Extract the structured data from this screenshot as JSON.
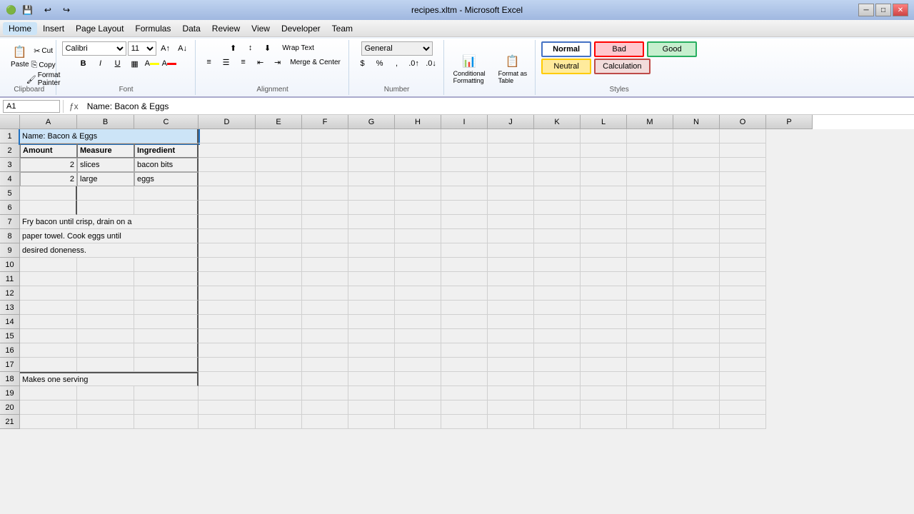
{
  "titlebar": {
    "text": "recipes.xltm - Microsoft Excel",
    "minimize": "─",
    "restore": "□",
    "close": "✕"
  },
  "menu": {
    "items": [
      "Home",
      "Insert",
      "Page Layout",
      "Formulas",
      "Data",
      "Review",
      "View",
      "Developer",
      "Team"
    ]
  },
  "ribbon": {
    "clipboard": {
      "label": "Clipboard",
      "paste": "Paste",
      "cut": "Cut",
      "copy": "Copy",
      "format_painter": "Format Painter"
    },
    "font": {
      "label": "Font",
      "family": "Calibri",
      "size": "11",
      "bold": "B",
      "italic": "I",
      "underline": "U"
    },
    "alignment": {
      "label": "Alignment",
      "wrap_text": "Wrap Text",
      "merge_center": "Merge & Center"
    },
    "number": {
      "label": "Number",
      "format": "General"
    },
    "styles": {
      "label": "Styles",
      "normal": "Normal",
      "bad": "Bad",
      "neutral": "Neutral",
      "calculation": "Calculation"
    }
  },
  "formula_bar": {
    "cell_ref": "A1",
    "formula": "Name: Bacon & Eggs"
  },
  "columns": [
    "A",
    "B",
    "C",
    "D",
    "E",
    "F",
    "G",
    "H",
    "I",
    "J",
    "K",
    "L",
    "M",
    "N",
    "O",
    "P"
  ],
  "rows": [
    {
      "num": 1,
      "cells": [
        "Name: Bacon & Eggs",
        "",
        "",
        "",
        "",
        "",
        "",
        "",
        "",
        "",
        "",
        "",
        "",
        "",
        "",
        ""
      ]
    },
    {
      "num": 2,
      "cells": [
        "Amount",
        "Measure",
        "Ingredient",
        "",
        "",
        "",
        "",
        "",
        "",
        "",
        "",
        "",
        "",
        "",
        "",
        ""
      ]
    },
    {
      "num": 3,
      "cells": [
        "2",
        "slices",
        "bacon bits",
        "",
        "",
        "",
        "",
        "",
        "",
        "",
        "",
        "",
        "",
        "",
        "",
        ""
      ]
    },
    {
      "num": 4,
      "cells": [
        "2",
        "large",
        "eggs",
        "",
        "",
        "",
        "",
        "",
        "",
        "",
        "",
        "",
        "",
        "",
        "",
        ""
      ]
    },
    {
      "num": 5,
      "cells": [
        "",
        "",
        "",
        "",
        "",
        "",
        "",
        "",
        "",
        "",
        "",
        "",
        "",
        "",
        "",
        ""
      ]
    },
    {
      "num": 6,
      "cells": [
        "",
        "",
        "",
        "",
        "",
        "",
        "",
        "",
        "",
        "",
        "",
        "",
        "",
        "",
        "",
        ""
      ]
    },
    {
      "num": 7,
      "cells": [
        "Fry bacon until crisp, drain on a",
        "",
        "",
        "",
        "",
        "",
        "",
        "",
        "",
        "",
        "",
        "",
        "",
        "",
        "",
        ""
      ]
    },
    {
      "num": 8,
      "cells": [
        "paper towel.  Cook eggs until",
        "",
        "",
        "",
        "",
        "",
        "",
        "",
        "",
        "",
        "",
        "",
        "",
        "",
        "",
        ""
      ]
    },
    {
      "num": 9,
      "cells": [
        "desired doneness.",
        "",
        "",
        "",
        "",
        "",
        "",
        "",
        "",
        "",
        "",
        "",
        "",
        "",
        "",
        ""
      ]
    },
    {
      "num": 10,
      "cells": [
        "",
        "",
        "",
        "",
        "",
        "",
        "",
        "",
        "",
        "",
        "",
        "",
        "",
        "",
        "",
        ""
      ]
    },
    {
      "num": 11,
      "cells": [
        "",
        "",
        "",
        "",
        "",
        "",
        "",
        "",
        "",
        "",
        "",
        "",
        "",
        "",
        "",
        ""
      ]
    },
    {
      "num": 12,
      "cells": [
        "",
        "",
        "",
        "",
        "",
        "",
        "",
        "",
        "",
        "",
        "",
        "",
        "",
        "",
        "",
        ""
      ]
    },
    {
      "num": 13,
      "cells": [
        "",
        "",
        "",
        "",
        "",
        "",
        "",
        "",
        "",
        "",
        "",
        "",
        "",
        "",
        "",
        ""
      ]
    },
    {
      "num": 14,
      "cells": [
        "",
        "",
        "",
        "",
        "",
        "",
        "",
        "",
        "",
        "",
        "",
        "",
        "",
        "",
        "",
        ""
      ]
    },
    {
      "num": 15,
      "cells": [
        "",
        "",
        "",
        "",
        "",
        "",
        "",
        "",
        "",
        "",
        "",
        "",
        "",
        "",
        "",
        ""
      ]
    },
    {
      "num": 16,
      "cells": [
        "",
        "",
        "",
        "",
        "",
        "",
        "",
        "",
        "",
        "",
        "",
        "",
        "",
        "",
        "",
        ""
      ]
    },
    {
      "num": 17,
      "cells": [
        "",
        "",
        "",
        "",
        "",
        "",
        "",
        "",
        "",
        "",
        "",
        "",
        "",
        "",
        "",
        ""
      ]
    },
    {
      "num": 18,
      "cells": [
        "Makes one serving",
        "",
        "",
        "",
        "",
        "",
        "",
        "",
        "",
        "",
        "",
        "",
        "",
        "",
        "",
        ""
      ]
    },
    {
      "num": 19,
      "cells": [
        "",
        "",
        "",
        "",
        "",
        "",
        "",
        "",
        "",
        "",
        "",
        "",
        "",
        "",
        "",
        ""
      ]
    },
    {
      "num": 20,
      "cells": [
        "",
        "",
        "",
        "",
        "",
        "",
        "",
        "",
        "",
        "",
        "",
        "",
        "",
        "",
        "",
        ""
      ]
    },
    {
      "num": 21,
      "cells": [
        "",
        "",
        "",
        "",
        "",
        "",
        "",
        "",
        "",
        "",
        "",
        "",
        "",
        "",
        "",
        ""
      ]
    }
  ]
}
